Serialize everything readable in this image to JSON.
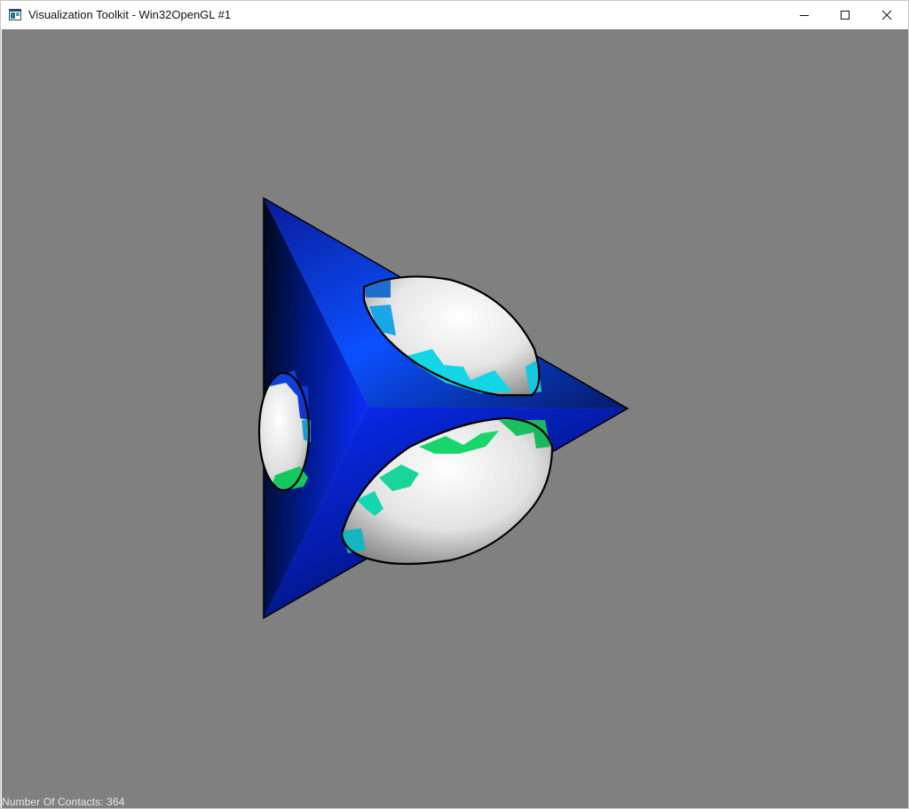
{
  "window": {
    "title": "Visualization Toolkit - Win32OpenGL #1",
    "icon": "vtk-app-icon",
    "controls": {
      "minimize": "minimize-icon",
      "maximize": "maximize-icon",
      "close": "close-icon"
    }
  },
  "viewport": {
    "background_color": "#808080",
    "status_text": "Number Of Contacts: 364"
  },
  "scene": {
    "objects": [
      "blue-tetrahedron",
      "white-sphere-upper",
      "white-sphere-left",
      "white-sphere-lower"
    ],
    "colors": {
      "tetrahedron": "#0a2cff",
      "sphere": "#f2f2f2",
      "contact_cyan": "#14d6e0",
      "contact_green": "#18d66a",
      "contact_blue": "#1460c8"
    }
  }
}
